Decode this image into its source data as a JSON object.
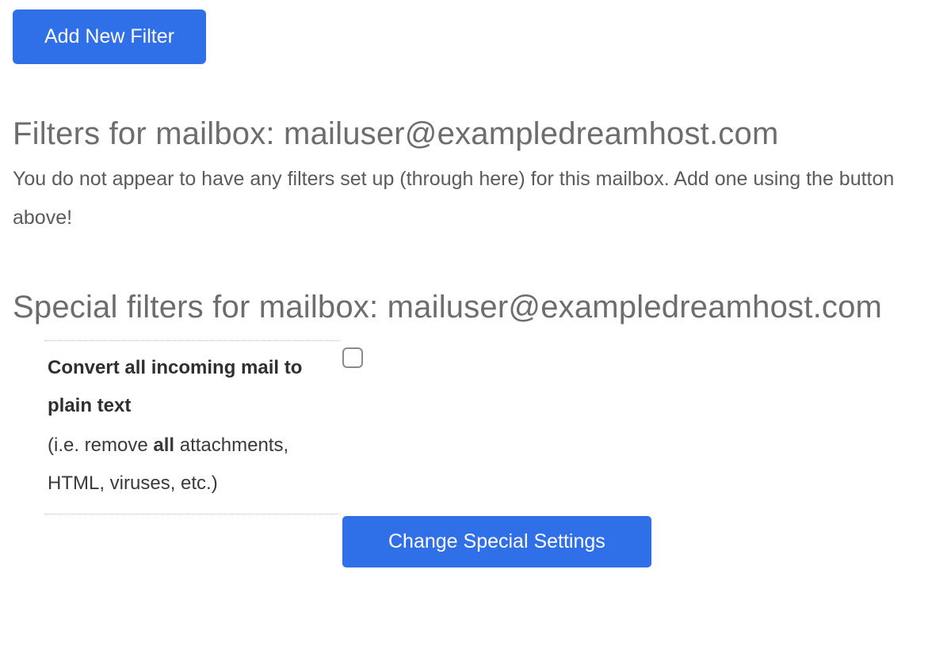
{
  "add_filter_button": "Add New Filter",
  "filters_heading": "Filters for mailbox: mailuser@exampledreamhost.com",
  "no_filters_text": "You do not appear to have any filters set up (through here) for this mailbox. Add one using the button above!",
  "special_heading": "Special filters for mailbox: mailuser@exampledreamhost.com",
  "convert_option": {
    "label_bold": "Convert all incoming mail to plain text",
    "paren_pre": "(i.e. remove ",
    "paren_bold": "all",
    "paren_post": " attachments, HTML, viruses, etc.)",
    "checked": false
  },
  "change_button": "Change Special Settings"
}
